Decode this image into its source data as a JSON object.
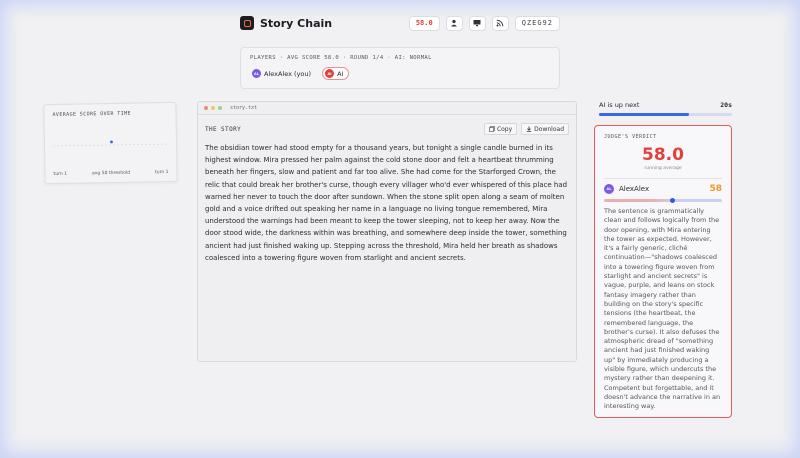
{
  "app": {
    "title": "Story Chain"
  },
  "header": {
    "score": "58.0",
    "icons": [
      "person-icon",
      "monitor-icon",
      "rss-icon"
    ],
    "room_code": "QZEG92"
  },
  "players_panel": {
    "meta": "PLAYERS · AVG SCORE 58.0 · ROUND 1/4 · AI: NORMAL",
    "players": [
      {
        "initials": "AL",
        "label": "AlexAlex (you)",
        "color": "#7a5ae6"
      },
      {
        "initials": "AI",
        "label": "AI",
        "color": "#e0403a"
      }
    ]
  },
  "avg_chart": {
    "title": "AVERAGE SCORE OVER TIME",
    "left_label": "turn 1",
    "mid_label": "avg 50 threshold",
    "right_label": "turn 1",
    "chart_data": {
      "type": "scatter",
      "x": [
        1
      ],
      "y": [
        58
      ],
      "ylim": [
        0,
        100
      ],
      "threshold": 50
    }
  },
  "story": {
    "filename": "story.txt",
    "label": "THE STORY",
    "copy_label": "Copy",
    "download_label": "Download",
    "text": "The obsidian tower had stood empty for a thousand years, but tonight a single candle burned in its highest window. Mira pressed her palm against the cold stone door and felt a heartbeat thrumming beneath her fingers, slow and patient and far too alive. She had come for the Starforged Crown, the relic that could break her brother's curse, though every villager who'd ever whispered of this place had warned her never to touch the door after sundown. When the stone split open along a seam of molten gold and a voice drifted out speaking her name in a language no living tongue remembered, Mira understood the warnings had been meant to keep the tower sleeping, not to keep her away. Now the door stood wide, the darkness within was breathing, and somewhere deep inside the tower, something ancient had just finished waking up. Stepping across the threshold, Mira held her breath as shadows coalesced into a towering figure woven from starlight and ancient secrets."
  },
  "turn": {
    "label": "AI is up next",
    "timer": "20s",
    "progress": 0.68
  },
  "verdict": {
    "title": "JUDGE'S VERDICT",
    "score": "58.0",
    "score_sub": "running average",
    "player_initials": "AL",
    "player_name": "AlexAlex",
    "player_score": "58",
    "player_score_value": 58,
    "text": "The sentence is grammatically clean and follows logically from the door opening, with Mira entering the tower as expected. However, it's a fairly generic, cliché continuation—\"shadows coalesced into a towering figure woven from starlight and ancient secrets\" is vague, purple, and leans on stock fantasy imagery rather than building on the story's specific tensions (the heartbeat, the remembered language, the brother's curse). It also defuses the atmospheric dread of \"something ancient had just finished waking up\" by immediately producing a visible figure, which undercuts the mystery rather than deepening it. Competent but forgettable, and it doesn't advance the narrative in an interesting way."
  },
  "colors": {
    "accent_red": "#e2403a",
    "accent_blue": "#3a66e8",
    "score_orange": "#f0962a"
  }
}
